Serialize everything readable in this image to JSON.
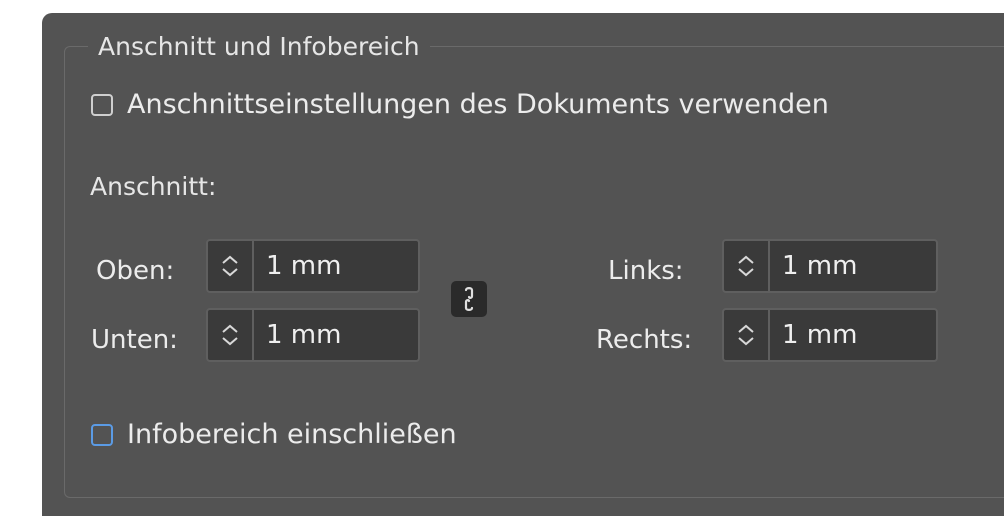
{
  "group": {
    "title": "Anschnitt und Infobereich"
  },
  "use_document_settings": {
    "label": "Anschnittseinstellungen des Dokuments verwenden",
    "checked": false
  },
  "bleed": {
    "section_label": "Anschnitt:",
    "top": {
      "label": "Oben:",
      "value": "1 mm"
    },
    "bottom": {
      "label": "Unten:",
      "value": "1 mm"
    },
    "left": {
      "label": "Links:",
      "value": "1 mm"
    },
    "right": {
      "label": "Rechts:",
      "value": "1 mm"
    },
    "link_icon": "chain-link-icon",
    "linked": true
  },
  "include_slug": {
    "label": "Infobereich einschließen",
    "checked": false
  },
  "colors": {
    "panel_background": "#535353",
    "field_background": "#3a3a3a",
    "focus_ring": "#5b9be5"
  }
}
